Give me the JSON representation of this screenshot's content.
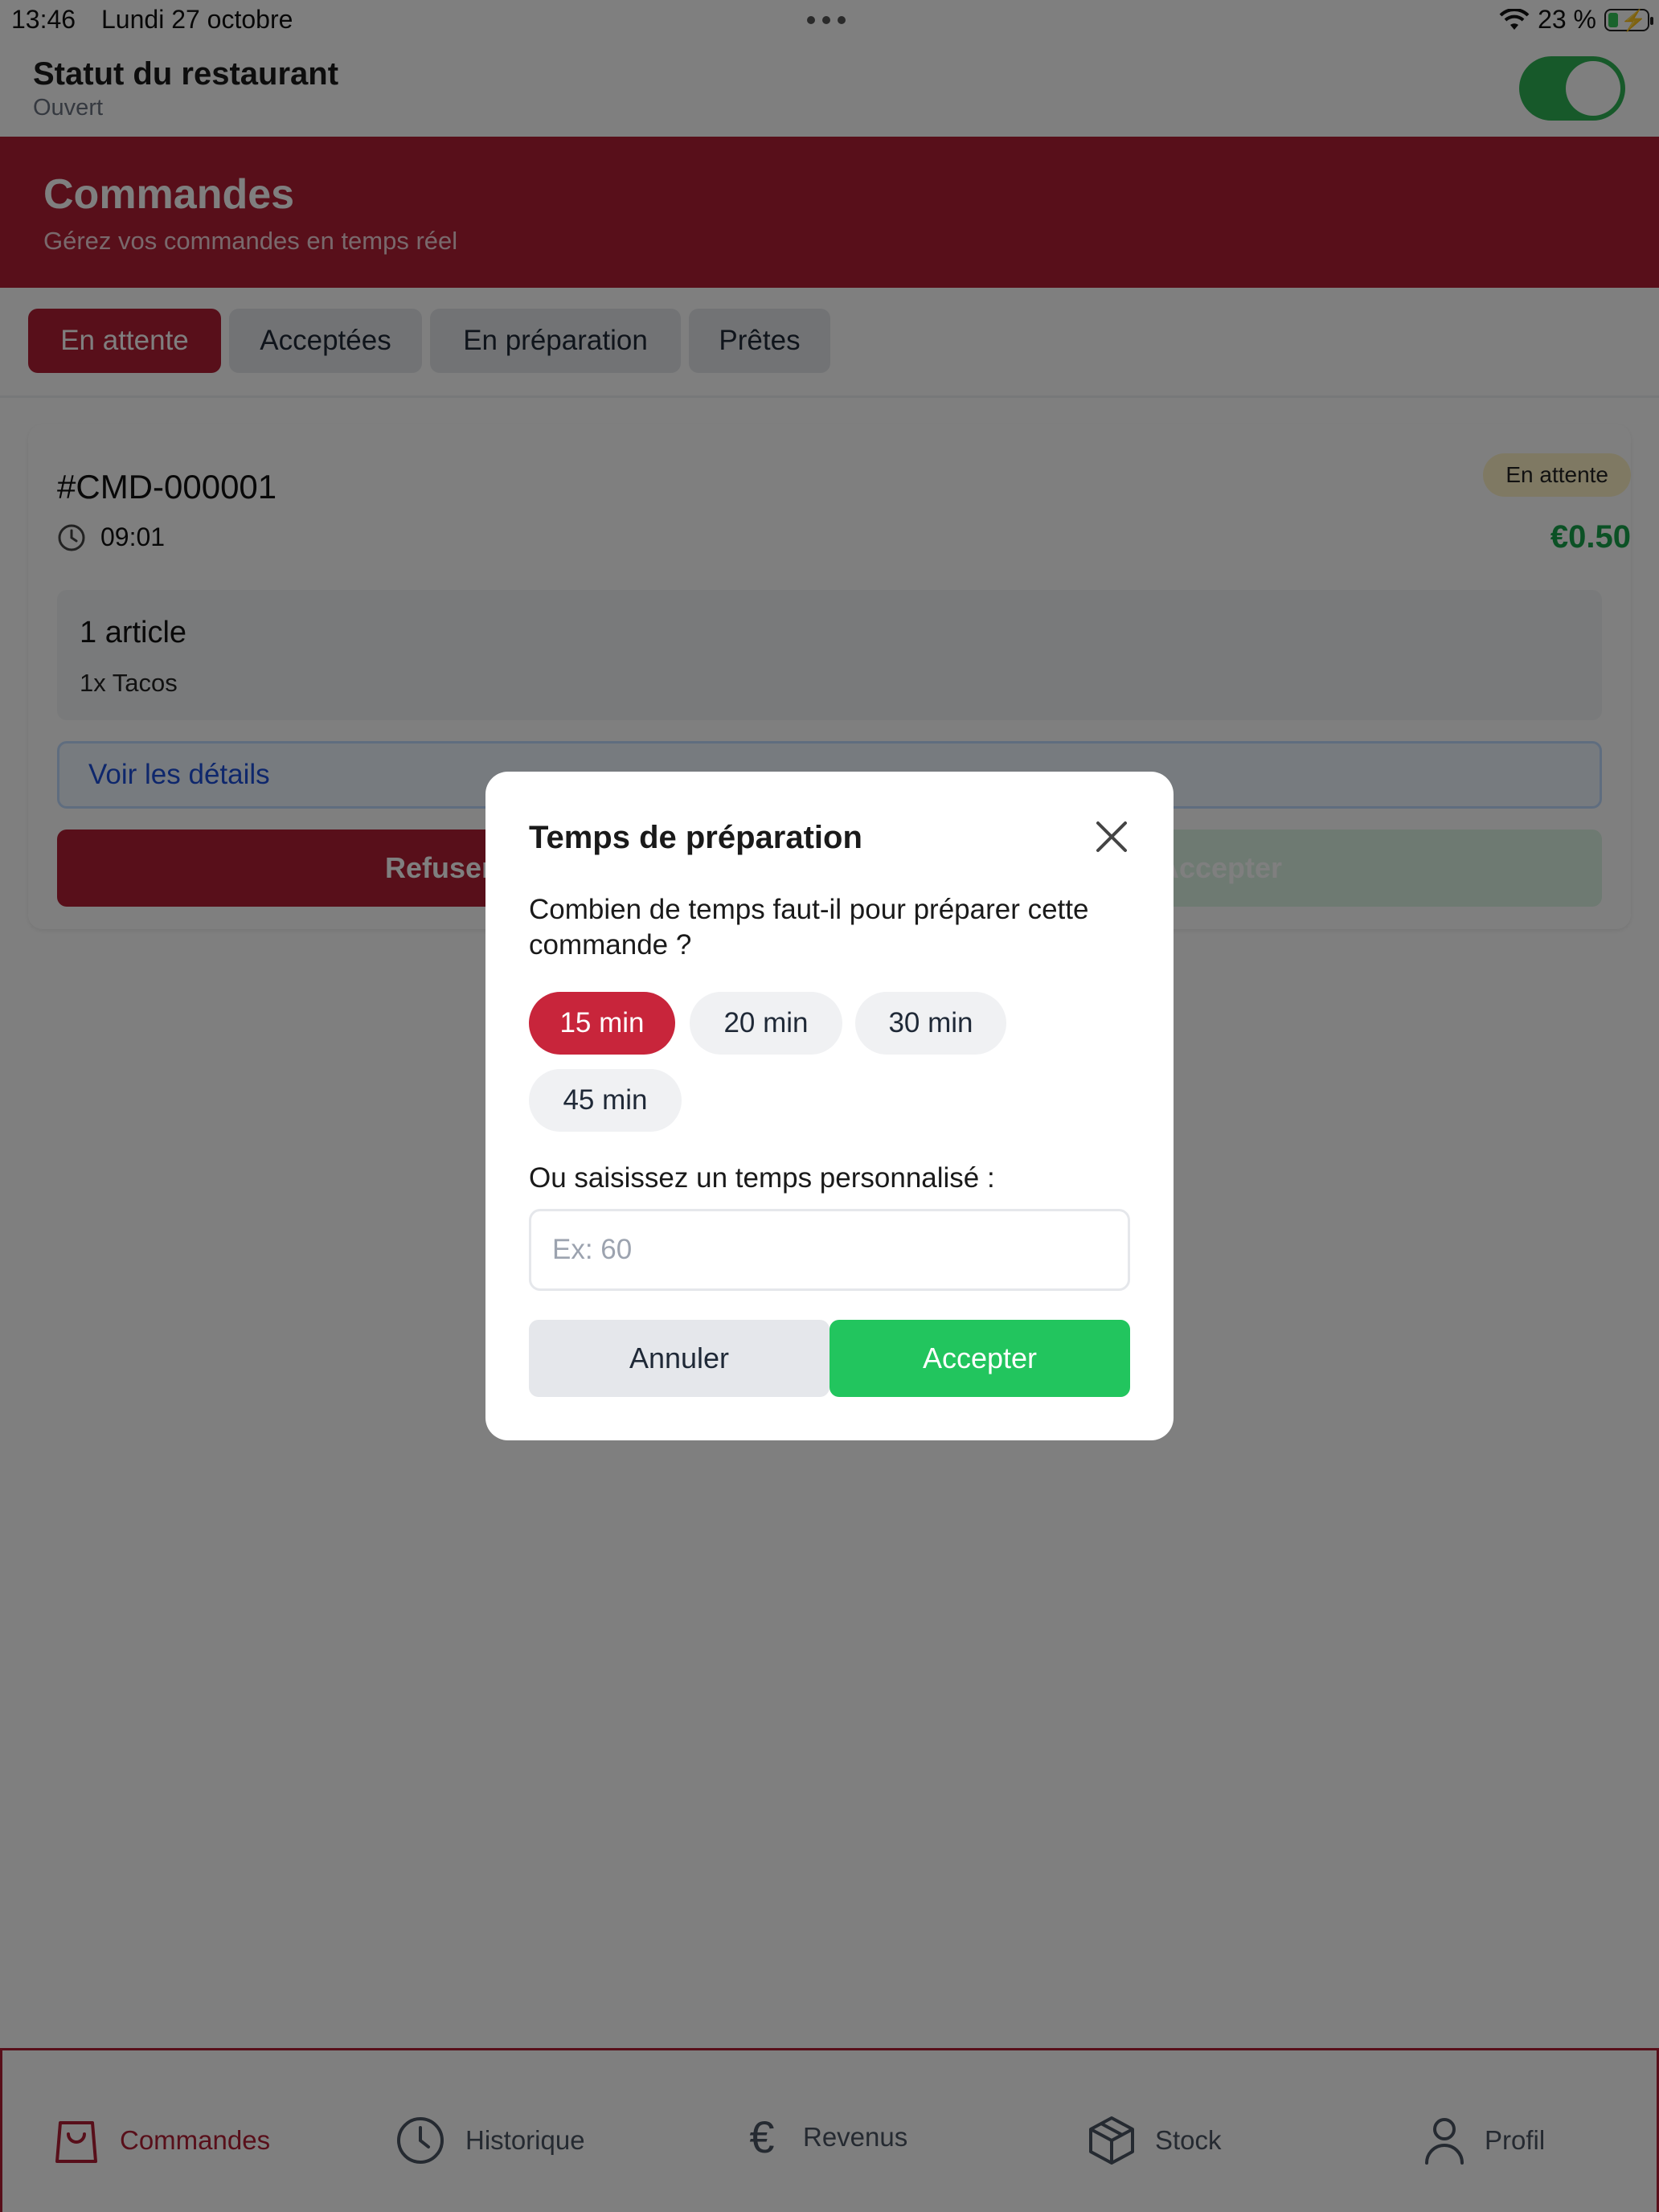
{
  "statusbar": {
    "time": "13:46",
    "date": "Lundi 27 octobre",
    "battery": "23 %"
  },
  "restaurant": {
    "title": "Statut du restaurant",
    "status": "Ouvert",
    "toggle_on": true
  },
  "header": {
    "title": "Commandes",
    "subtitle": "Gérez vos commandes en temps réel"
  },
  "tabs": [
    {
      "label": "En attente",
      "active": true
    },
    {
      "label": "Acceptées",
      "active": false
    },
    {
      "label": "En préparation",
      "active": false
    },
    {
      "label": "Prêtes",
      "active": false
    }
  ],
  "order": {
    "id": "#CMD-000001",
    "time": "09:01",
    "status_badge": "En attente",
    "price": "€0.50",
    "items_count": "1 article",
    "items": [
      "1x Tacos"
    ],
    "details_label": "Voir les détails",
    "refuse_label": "Refuser",
    "accept_label": "Accepter"
  },
  "modal": {
    "title": "Temps de préparation",
    "question": "Combien de temps faut-il pour préparer cette commande ?",
    "options": [
      "15 min",
      "20 min",
      "30 min",
      "45 min"
    ],
    "selected": "15 min",
    "custom_label": "Ou saisissez un temps personnalisé :",
    "custom_placeholder": "Ex: 60",
    "custom_value": "",
    "cancel_label": "Annuler",
    "accept_label": "Accepter"
  },
  "bottomnav": [
    {
      "label": "Commandes",
      "icon": "shopping-bag-icon",
      "active": true
    },
    {
      "label": "Historique",
      "icon": "clock-icon",
      "active": false
    },
    {
      "label": "Revenus",
      "icon": "euro-icon",
      "active": false
    },
    {
      "label": "Stock",
      "icon": "box-icon",
      "active": false
    },
    {
      "label": "Profil",
      "icon": "user-icon",
      "active": false
    }
  ],
  "colors": {
    "brand": "#b11e35",
    "success": "#22c55e",
    "price": "#16a34a"
  }
}
